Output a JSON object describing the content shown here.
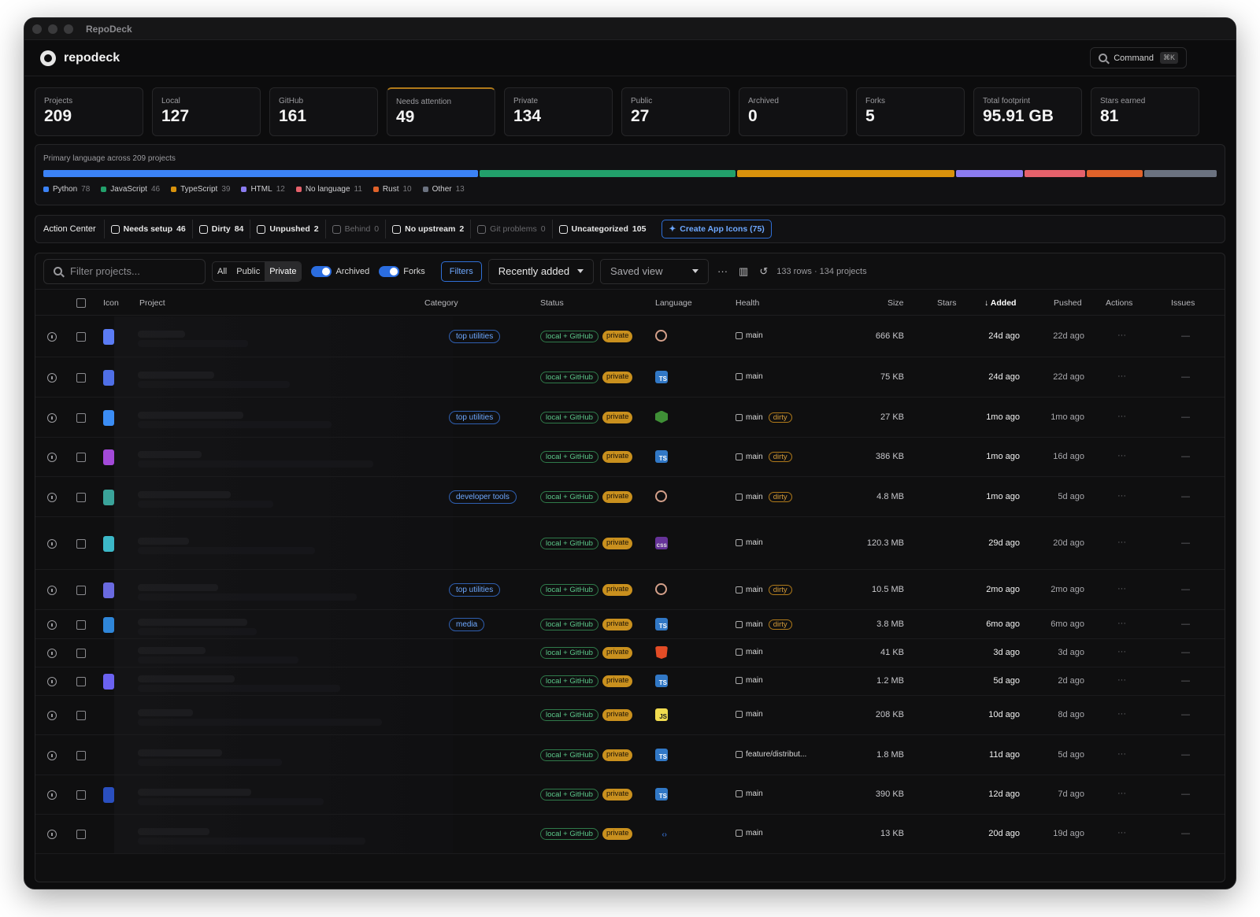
{
  "window": {
    "title": "RepoDeck"
  },
  "app": {
    "brand": "repodeck",
    "command_label": "Command",
    "command_shortcut": "⌘K"
  },
  "stats": [
    {
      "label": "Projects",
      "value": "209"
    },
    {
      "label": "Local",
      "value": "127"
    },
    {
      "label": "GitHub",
      "value": "161"
    },
    {
      "label": "Needs attention",
      "value": "49"
    },
    {
      "label": "Private",
      "value": "134"
    },
    {
      "label": "Public",
      "value": "27"
    },
    {
      "label": "Archived",
      "value": "0"
    },
    {
      "label": "Forks",
      "value": "5"
    },
    {
      "label": "Total footprint",
      "value": "95.91 GB"
    },
    {
      "label": "Stars earned",
      "value": "81"
    }
  ],
  "languages": {
    "title": "Primary language across 209 projects",
    "items": [
      {
        "name": "Python",
        "count": 78,
        "color": "#3b82f6"
      },
      {
        "name": "JavaScript",
        "count": 46,
        "color": "#22a06b"
      },
      {
        "name": "TypeScript",
        "count": 39,
        "color": "#d9920c"
      },
      {
        "name": "HTML",
        "count": 12,
        "color": "#8b7cf0"
      },
      {
        "name": "No language",
        "count": 11,
        "color": "#e5616b"
      },
      {
        "name": "Rust",
        "count": 10,
        "color": "#e0622a"
      },
      {
        "name": "Other",
        "count": 13,
        "color": "#6b7280"
      }
    ]
  },
  "action_center": {
    "title": "Action Center",
    "chips": [
      {
        "label": "Needs setup",
        "count": "46",
        "dim": false
      },
      {
        "label": "Dirty",
        "count": "84",
        "dim": false
      },
      {
        "label": "Unpushed",
        "count": "2",
        "dim": false
      },
      {
        "label": "Behind",
        "count": "0",
        "dim": true
      },
      {
        "label": "No upstream",
        "count": "2",
        "dim": false
      },
      {
        "label": "Git problems",
        "count": "0",
        "dim": true
      },
      {
        "label": "Uncategorized",
        "count": "105",
        "dim": false
      }
    ],
    "cta": "Create App Icons (75)"
  },
  "toolbar": {
    "search_placeholder": "Filter projects...",
    "segments": [
      "All",
      "Public",
      "Private"
    ],
    "active_segment": "Private",
    "archived_label": "Archived",
    "forks_label": "Forks",
    "filters_label": "Filters",
    "sort_label": "Recently added",
    "saved_view_label": "Saved view",
    "more_icon": "···",
    "row_summary": "133 rows · 134 projects"
  },
  "columns": {
    "icon": "Icon",
    "project": "Project",
    "category": "Category",
    "status": "Status",
    "language": "Language",
    "health": "Health",
    "size": "Size",
    "stars": "Stars",
    "added": "Added",
    "pushed": "Pushed",
    "actions": "Actions",
    "issues": "Issues"
  },
  "rows": [
    {
      "icon_color": "#5b7cf5",
      "category": "top utilities",
      "status": "local + GitHub",
      "visibility": "private",
      "lang": "rust",
      "branch": "main",
      "dirty": false,
      "size": "666 KB",
      "added": "24d ago",
      "pushed": "22d ago",
      "actions": "···",
      "issues": "—"
    },
    {
      "icon_color": "#4f6fe6",
      "category": "",
      "status": "local + GitHub",
      "visibility": "private",
      "lang": "ts",
      "branch": "main",
      "dirty": false,
      "size": "75 KB",
      "added": "24d ago",
      "pushed": "22d ago",
      "actions": "···",
      "issues": "—"
    },
    {
      "icon_color": "#3b8df5",
      "category": "top utilities",
      "status": "local + GitHub",
      "visibility": "private",
      "lang": "shell",
      "branch": "main",
      "dirty": true,
      "size": "27 KB",
      "added": "1mo ago",
      "pushed": "1mo ago",
      "actions": "···",
      "issues": "—"
    },
    {
      "icon_color": "#a34ad9",
      "category": "",
      "status": "local + GitHub",
      "visibility": "private",
      "lang": "ts",
      "branch": "main",
      "dirty": true,
      "size": "386 KB",
      "added": "1mo ago",
      "pushed": "16d ago",
      "actions": "···",
      "issues": "—"
    },
    {
      "icon_color": "#3aa39a",
      "category": "developer tools",
      "status": "local + GitHub",
      "visibility": "private",
      "lang": "rust",
      "branch": "main",
      "dirty": true,
      "size": "4.8 MB",
      "added": "1mo ago",
      "pushed": "5d ago",
      "actions": "···",
      "issues": "—"
    },
    {
      "icon_color": "#3cb8c8",
      "category": "",
      "status": "local + GitHub",
      "visibility": "private",
      "lang": "css",
      "branch": "main",
      "dirty": false,
      "size": "120.3 MB",
      "added": "29d ago",
      "pushed": "20d ago",
      "actions": "···",
      "issues": "—"
    },
    {
      "icon_color": "#6a6ae0",
      "category": "top utilities",
      "status": "local + GitHub",
      "visibility": "private",
      "lang": "rust",
      "branch": "main",
      "dirty": true,
      "size": "10.5 MB",
      "added": "2mo ago",
      "pushed": "2mo ago",
      "actions": "···",
      "issues": "—"
    },
    {
      "icon_color": "#2f86d9",
      "category": "media",
      "status": "local + GitHub",
      "visibility": "private",
      "lang": "ts",
      "branch": "main",
      "dirty": true,
      "size": "3.8 MB",
      "added": "6mo ago",
      "pushed": "6mo ago",
      "actions": "···",
      "issues": "—"
    },
    {
      "icon_color": "",
      "category": "",
      "status": "local + GitHub",
      "visibility": "private",
      "lang": "html",
      "branch": "main",
      "dirty": false,
      "size": "41 KB",
      "added": "3d ago",
      "pushed": "3d ago",
      "actions": "···",
      "issues": "—"
    },
    {
      "icon_color": "#6b62f0",
      "category": "",
      "status": "local + GitHub",
      "visibility": "private",
      "lang": "ts",
      "branch": "main",
      "dirty": false,
      "size": "1.2 MB",
      "added": "5d ago",
      "pushed": "2d ago",
      "actions": "···",
      "issues": "—"
    },
    {
      "icon_color": "",
      "category": "",
      "status": "local + GitHub",
      "visibility": "private",
      "lang": "js",
      "branch": "main",
      "dirty": false,
      "size": "208 KB",
      "added": "10d ago",
      "pushed": "8d ago",
      "actions": "···",
      "issues": "—"
    },
    {
      "icon_color": "",
      "category": "",
      "status": "local + GitHub",
      "visibility": "private",
      "lang": "ts",
      "branch": "feature/distribut...",
      "dirty": false,
      "size": "1.8 MB",
      "added": "11d ago",
      "pushed": "5d ago",
      "actions": "···",
      "issues": "—"
    },
    {
      "icon_color": "#2a4fbf",
      "category": "",
      "status": "local + GitHub",
      "visibility": "private",
      "lang": "ts",
      "branch": "main",
      "dirty": false,
      "size": "390 KB",
      "added": "12d ago",
      "pushed": "7d ago",
      "actions": "···",
      "issues": "—"
    },
    {
      "icon_color": "",
      "category": "",
      "status": "local + GitHub",
      "visibility": "private",
      "lang": "code",
      "branch": "main",
      "dirty": false,
      "size": "13 KB",
      "added": "20d ago",
      "pushed": "19d ago",
      "actions": "···",
      "issues": "—"
    }
  ]
}
